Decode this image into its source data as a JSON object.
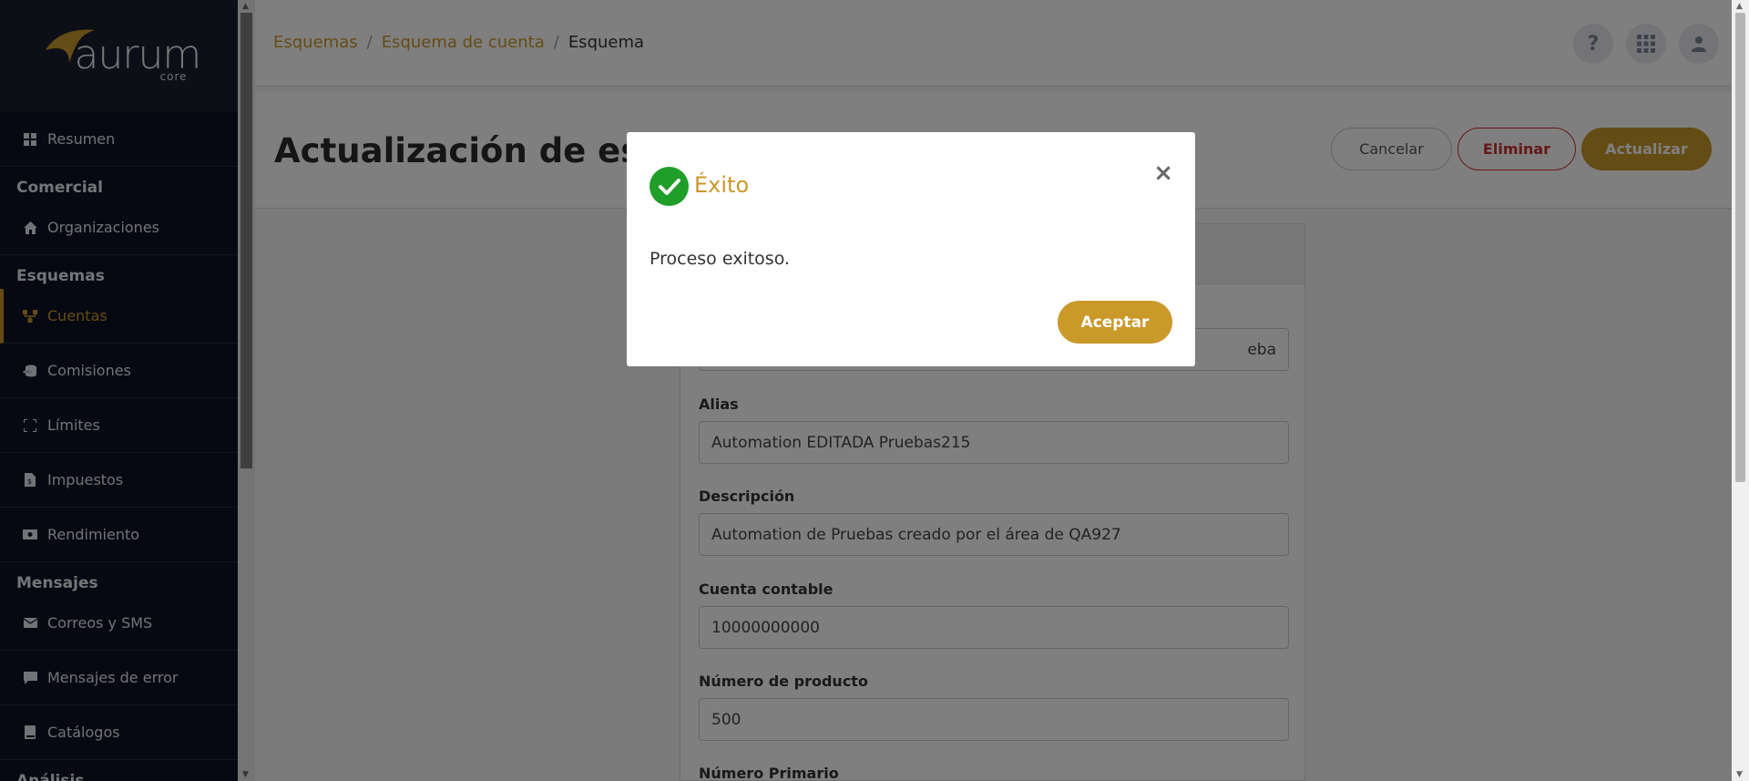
{
  "brand": {
    "name": "aurum",
    "sub": "core"
  },
  "sidebar": {
    "items": [
      {
        "type": "item",
        "label": "Resumen",
        "icon": "grid-icon"
      },
      {
        "type": "section",
        "label": "Comercial"
      },
      {
        "type": "item",
        "label": "Organizaciones",
        "icon": "home-icon"
      },
      {
        "type": "section",
        "label": "Esquemas"
      },
      {
        "type": "item",
        "label": "Cuentas",
        "icon": "network-icon",
        "active": true
      },
      {
        "type": "item",
        "label": "Comisiones",
        "icon": "coins-icon"
      },
      {
        "type": "item",
        "label": "Límites",
        "icon": "expand-icon"
      },
      {
        "type": "item",
        "label": "Impuestos",
        "icon": "receipt-icon"
      },
      {
        "type": "item",
        "label": "Rendimiento",
        "icon": "money-icon"
      },
      {
        "type": "section",
        "label": "Mensajes"
      },
      {
        "type": "item",
        "label": "Correos y SMS",
        "icon": "envelope-icon"
      },
      {
        "type": "item",
        "label": "Mensajes de error",
        "icon": "comment-icon"
      },
      {
        "type": "item",
        "label": "Catálogos",
        "icon": "book-icon"
      },
      {
        "type": "section",
        "label": "Análisis"
      }
    ]
  },
  "breadcrumb": {
    "items": [
      "Esquemas",
      "Esquema de cuenta",
      "Esquema"
    ],
    "sep": "/"
  },
  "page": {
    "title": "Actualización de esquema de cuenta",
    "cancel_label": "Cancelar",
    "delete_label": "Eliminar",
    "update_label": "Actualizar"
  },
  "form": {
    "partial_value": "eba",
    "alias_label": "Alias",
    "alias_value": "Automation EDITADA Pruebas215",
    "desc_label": "Descripción",
    "desc_value": "Automation de Pruebas creado por el área de QA927",
    "account_label": "Cuenta contable",
    "account_value": "10000000000",
    "product_label": "Número de producto",
    "product_value": "500",
    "primary_label": "Número Primario"
  },
  "modal": {
    "title": "Éxito",
    "message": "Proceso exitoso.",
    "ok_label": "Aceptar",
    "close_glyph": "×"
  },
  "colors": {
    "accent": "#c9992a",
    "sidebar": "#0f1224",
    "success": "#1f9e2a",
    "danger": "#c93030"
  }
}
